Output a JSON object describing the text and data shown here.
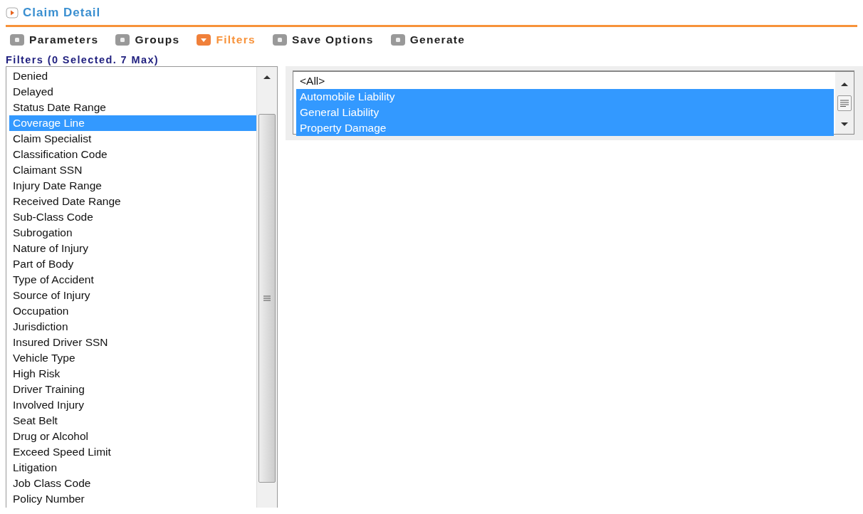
{
  "header": {
    "title": "Claim Detail"
  },
  "steps": [
    {
      "label": "Parameters",
      "selected": false
    },
    {
      "label": "Groups",
      "selected": false
    },
    {
      "label": "Filters",
      "selected": true
    },
    {
      "label": "Save Options",
      "selected": false
    },
    {
      "label": "Generate",
      "selected": false
    }
  ],
  "filters": {
    "label": "Filters (0 Selected. 7 Max)",
    "items": [
      {
        "label": "Denied",
        "selected": false
      },
      {
        "label": "Delayed",
        "selected": false
      },
      {
        "label": "Status Date Range",
        "selected": false
      },
      {
        "label": "Coverage Line",
        "selected": true
      },
      {
        "label": "Claim Specialist",
        "selected": false
      },
      {
        "label": "Classification Code",
        "selected": false
      },
      {
        "label": "Claimant SSN",
        "selected": false
      },
      {
        "label": "Injury Date Range",
        "selected": false
      },
      {
        "label": "Received Date Range",
        "selected": false
      },
      {
        "label": "Sub-Class Code",
        "selected": false
      },
      {
        "label": "Subrogation",
        "selected": false
      },
      {
        "label": "Nature of Injury",
        "selected": false
      },
      {
        "label": "Part of Body",
        "selected": false
      },
      {
        "label": "Type of Accident",
        "selected": false
      },
      {
        "label": "Source of Injury",
        "selected": false
      },
      {
        "label": "Occupation",
        "selected": false
      },
      {
        "label": "Jurisdiction",
        "selected": false
      },
      {
        "label": "Insured Driver SSN",
        "selected": false
      },
      {
        "label": "Vehicle Type",
        "selected": false
      },
      {
        "label": "High Risk",
        "selected": false
      },
      {
        "label": "Driver Training",
        "selected": false
      },
      {
        "label": "Involved Injury",
        "selected": false
      },
      {
        "label": "Seat Belt",
        "selected": false
      },
      {
        "label": "Drug or Alcohol",
        "selected": false
      },
      {
        "label": "Exceed Speed Limit",
        "selected": false
      },
      {
        "label": "Litigation",
        "selected": false
      },
      {
        "label": "Job Class Code",
        "selected": false
      },
      {
        "label": "Policy Number",
        "selected": false
      }
    ]
  },
  "values": {
    "items": [
      {
        "label": "<All>",
        "selected": false
      },
      {
        "label": "Automobile Liability",
        "selected": true
      },
      {
        "label": "General Liability",
        "selected": true
      },
      {
        "label": "Property Damage",
        "selected": true
      }
    ]
  }
}
